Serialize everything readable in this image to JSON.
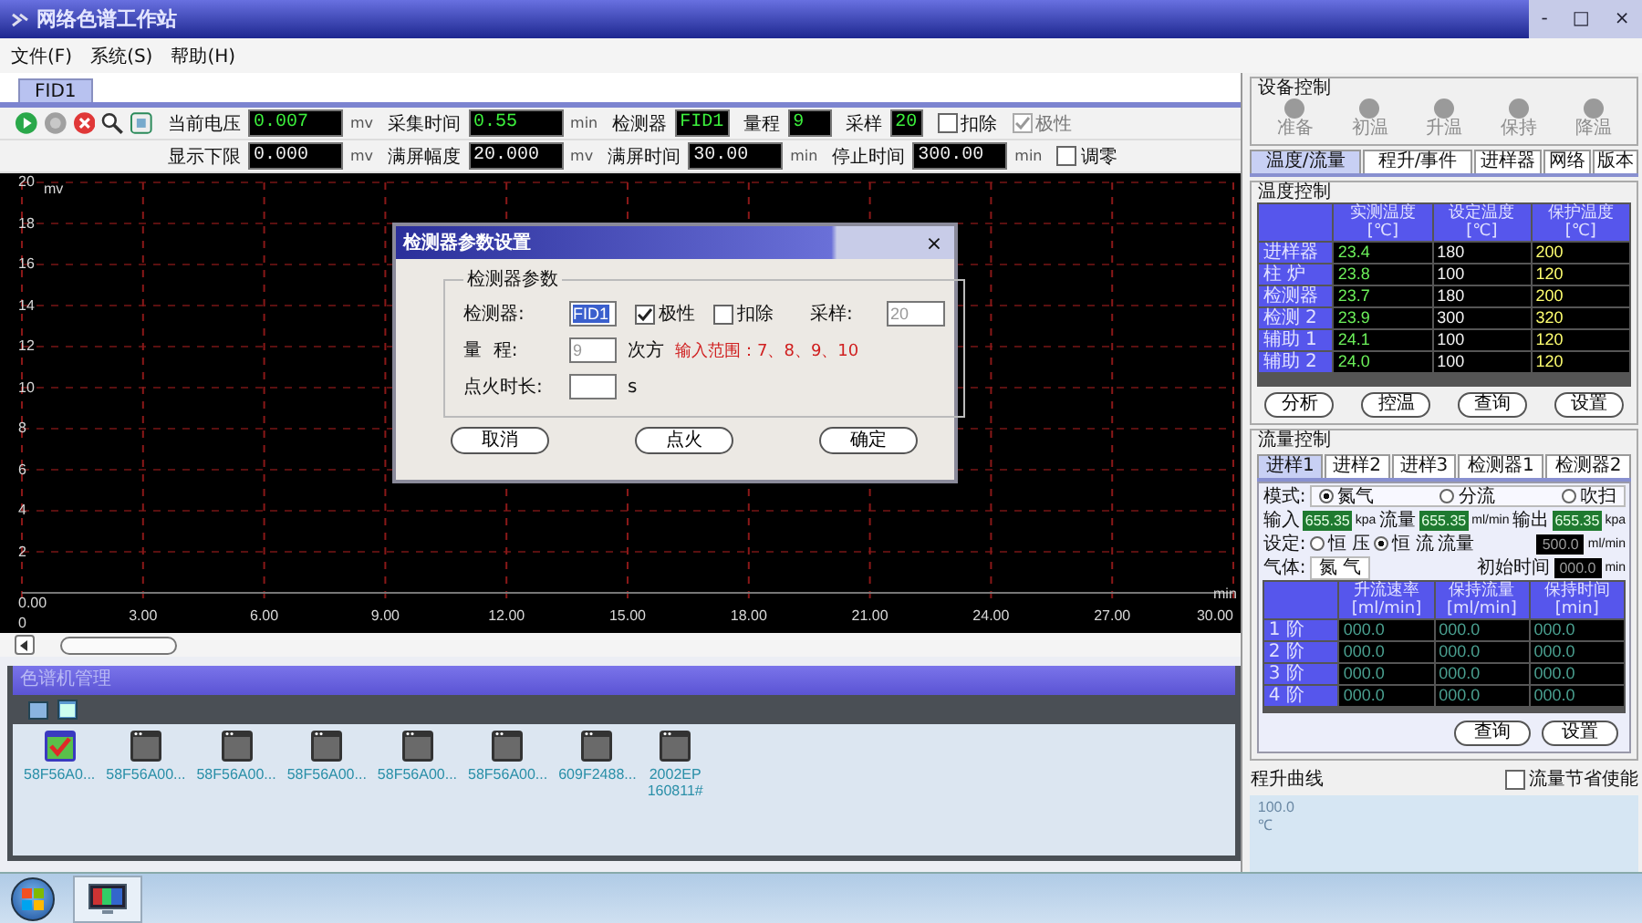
{
  "window": {
    "title": "网络色谱工作站",
    "controls": [
      "-",
      "□",
      "×"
    ]
  },
  "menu": [
    "文件(F)",
    "系统(S)",
    "帮助(H)"
  ],
  "doc_tabs": [
    {
      "label": "FID1",
      "selected": true
    }
  ],
  "status_rows": [
    [
      {
        "kind": "reading",
        "label": "当前电压",
        "value": "0.007",
        "unit": "mv"
      },
      {
        "kind": "reading",
        "label": "采集时间",
        "value": "0.55",
        "unit": "min"
      },
      {
        "kind": "reading",
        "label": "检测器",
        "value": "FID1"
      },
      {
        "kind": "reading",
        "label": "量程",
        "value": "9"
      },
      {
        "kind": "reading",
        "label": "采样",
        "value": "20"
      },
      {
        "kind": "checkbox",
        "label": "扣除",
        "checked": false,
        "disabled": false
      },
      {
        "kind": "checkbox",
        "label": "极性",
        "checked": true,
        "disabled": true
      }
    ],
    [
      {
        "kind": "setting",
        "label": "显示下限",
        "value": "0.000",
        "unit": "mv"
      },
      {
        "kind": "setting",
        "label": "满屏幅度",
        "value": "20.000",
        "unit": "mv"
      },
      {
        "kind": "setting",
        "label": "满屏时间",
        "value": "30.00",
        "unit": "min"
      },
      {
        "kind": "setting",
        "label": "停止时间",
        "value": "300.00",
        "unit": "min"
      },
      {
        "kind": "checkbox",
        "label": "调零",
        "checked": false,
        "disabled": false
      }
    ]
  ],
  "plot": {
    "y_unit": "mv",
    "y_ticks": [
      "20",
      "18",
      "16",
      "14",
      "12",
      "10",
      "8",
      "6",
      "4",
      "2"
    ],
    "origin": "0",
    "x_ticks": [
      "0.00",
      "3.00",
      "6.00",
      "9.00",
      "12.00",
      "15.00",
      "18.00",
      "21.00",
      "24.00",
      "27.00",
      "30.00"
    ],
    "x_unit": "min"
  },
  "dialog": {
    "title": "检测器参数设置",
    "close": "×",
    "group_title": "检测器参数",
    "detector_label": "检测器:",
    "detector_value": "FID1",
    "polarity": {
      "label": "极性",
      "checked": true
    },
    "subtract": {
      "label": "扣除",
      "checked": false
    },
    "sampling_label": "采样:",
    "sampling": {
      "value": "20",
      "disabled": true
    },
    "range_label": "量  程:",
    "range": {
      "value": "9",
      "disabled": true
    },
    "range_unit": "次方",
    "range_hint": "输入范围：7、8、9、10",
    "ignition_label": "点火时长:",
    "ignition_unit": "s",
    "buttons": [
      "取消",
      "点火",
      "确定"
    ]
  },
  "manager": {
    "title": "色谱机管理",
    "items": [
      {
        "label": "58F56A0...",
        "selected": true
      },
      {
        "label": "58F56A00...",
        "selected": false
      },
      {
        "label": "58F56A00...",
        "selected": false
      },
      {
        "label": "58F56A00...",
        "selected": false
      },
      {
        "label": "58F56A00...",
        "selected": false
      },
      {
        "label": "58F56A00...",
        "selected": false
      },
      {
        "label": "609F2488...",
        "selected": false
      },
      {
        "label": "2002EP\n160811#",
        "selected": false
      }
    ]
  },
  "device_control": {
    "title": "设备控制",
    "indicators": [
      {
        "label": "准备",
        "on": false
      },
      {
        "label": "初温",
        "on": false
      },
      {
        "label": "升温",
        "on": false
      },
      {
        "label": "保持",
        "on": false
      },
      {
        "label": "降温",
        "on": false
      }
    ]
  },
  "right_tabs": [
    {
      "label": "温度/流量",
      "selected": true
    },
    {
      "label": "程升/事件",
      "selected": false
    },
    {
      "label": "进样器",
      "selected": false
    },
    {
      "label": "网络",
      "selected": false
    },
    {
      "label": "版本",
      "selected": false
    }
  ],
  "temperature": {
    "title": "温度控制",
    "columns": [
      {
        "name": "实测温度",
        "unit": "[℃]"
      },
      {
        "name": "设定温度",
        "unit": "[℃]"
      },
      {
        "name": "保护温度",
        "unit": "[℃]"
      }
    ],
    "rows": [
      {
        "name": "进样器",
        "values": [
          "23.4",
          "180",
          "200"
        ]
      },
      {
        "name": "柱 炉",
        "values": [
          "23.8",
          "100",
          "120"
        ]
      },
      {
        "name": "检测器",
        "values": [
          "23.7",
          "180",
          "200"
        ]
      },
      {
        "name": "检测 2",
        "values": [
          "23.9",
          "300",
          "320"
        ]
      },
      {
        "name": "辅助 1",
        "values": [
          "24.1",
          "100",
          "120"
        ]
      },
      {
        "name": "辅助 2",
        "values": [
          "24.0",
          "100",
          "120"
        ]
      }
    ],
    "buttons": [
      "分析",
      "控温",
      "查询",
      "设置"
    ]
  },
  "flow": {
    "title": "流量控制",
    "tabs": [
      {
        "label": "进样1",
        "selected": true
      },
      {
        "label": "进样2",
        "selected": false
      },
      {
        "label": "进样3",
        "selected": false
      },
      {
        "label": "检测器1",
        "selected": false
      },
      {
        "label": "检测器2",
        "selected": false
      }
    ],
    "mode_label": "模式:",
    "modes": [
      {
        "label": "氮气",
        "selected": true
      },
      {
        "label": "分流",
        "selected": false
      },
      {
        "label": "吹扫",
        "selected": false
      }
    ],
    "readings": [
      {
        "label": "输入",
        "value": "655.35",
        "unit": "kpa"
      },
      {
        "label": "流量",
        "value": "655.35",
        "unit": "ml/min"
      },
      {
        "label": "输出",
        "value": "655.35",
        "unit": "kpa"
      }
    ],
    "set_label": "设定:",
    "set_modes": [
      {
        "label": "恒 压",
        "selected": false
      },
      {
        "label": "恒 流",
        "selected": true
      }
    ],
    "flow_label": "流量",
    "flow_value": "500.0",
    "flow_unit": "ml/min",
    "gas_label": "气体:",
    "gas_value": "氮 气",
    "init_label": "初始时间",
    "init_value": "000.0",
    "init_unit": "min",
    "columns": [
      {
        "name": "升流速率",
        "unit": "[ml/min]"
      },
      {
        "name": "保持流量",
        "unit": "[ml/min]"
      },
      {
        "name": "保持时间",
        "unit": "[min]"
      }
    ],
    "rows": [
      {
        "name": "1 阶",
        "values": [
          "000.0",
          "000.0",
          "000.0"
        ]
      },
      {
        "name": "2 阶",
        "values": [
          "000.0",
          "000.0",
          "000.0"
        ]
      },
      {
        "name": "3 阶",
        "values": [
          "000.0",
          "000.0",
          "000.0"
        ]
      },
      {
        "name": "4 阶",
        "values": [
          "000.0",
          "000.0",
          "000.0"
        ]
      }
    ],
    "buttons": [
      "查询",
      "设置"
    ]
  },
  "program_curve": {
    "title": "程升曲线",
    "flow_saving": {
      "label": "流量节省使能",
      "checked": false
    },
    "y_value": "100.0",
    "y_unit": "℃"
  }
}
